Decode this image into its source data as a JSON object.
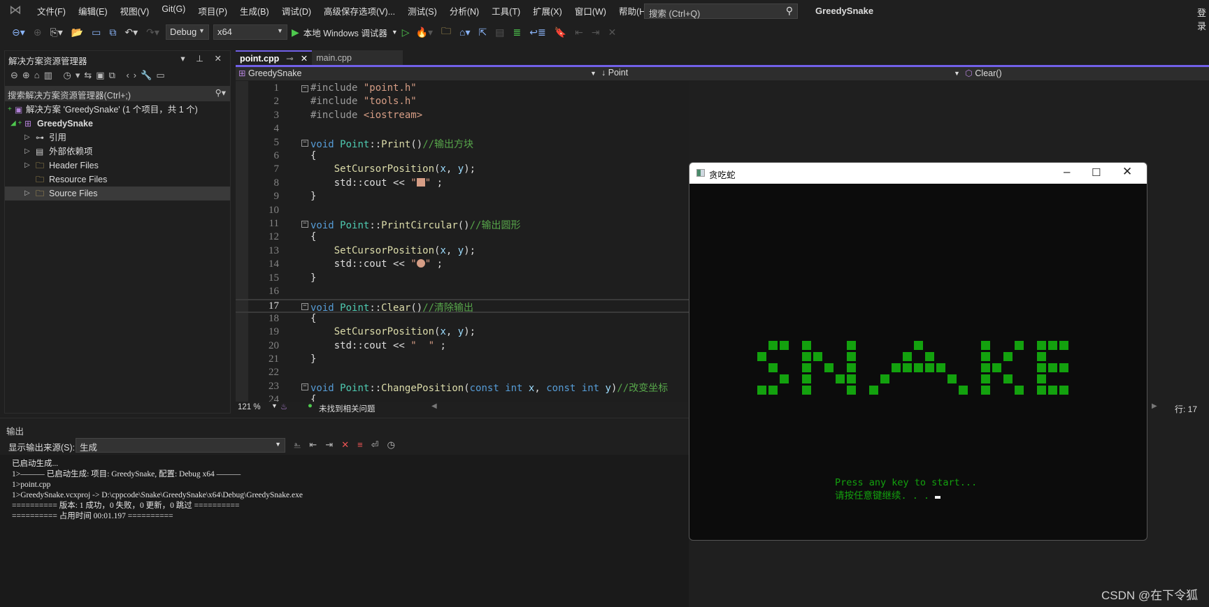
{
  "menubar": {
    "items": [
      "文件(F)",
      "编辑(E)",
      "视图(V)",
      "Git(G)",
      "项目(P)",
      "生成(B)",
      "调试(D)",
      "高级保存选项(V)...",
      "测试(S)",
      "分析(N)",
      "工具(T)",
      "扩展(X)",
      "窗口(W)",
      "帮助(H)"
    ],
    "search_placeholder": "搜索 (Ctrl+Q)",
    "app_title": "GreedySnake",
    "login": "登录"
  },
  "toolbar": {
    "config": "Debug",
    "platform": "x64",
    "run_label": "本地 Windows 调试器"
  },
  "solution_explorer": {
    "title": "解决方案资源管理器",
    "search_placeholder": "搜索解决方案资源管理器(Ctrl+;)",
    "items": [
      {
        "label": "解决方案 'GreedySnake' (1 个项目，共 1 个)",
        "icon": "solution-icon"
      },
      {
        "label": "GreedySnake",
        "icon": "project-icon"
      },
      {
        "label": "引用",
        "icon": "references-icon"
      },
      {
        "label": "外部依赖项",
        "icon": "external-deps-icon"
      },
      {
        "label": "Header Files",
        "icon": "filter-folder-icon"
      },
      {
        "label": "Resource Files",
        "icon": "filter-folder-icon"
      },
      {
        "label": "Source Files",
        "icon": "filter-folder-icon"
      }
    ]
  },
  "editor": {
    "tabs": [
      {
        "label": "point.cpp",
        "active": true
      },
      {
        "label": "main.cpp",
        "active": false
      }
    ],
    "nav": {
      "project": "GreedySnake",
      "scope": "Point",
      "member": "Clear()"
    },
    "current_line": 17,
    "lines": [
      [
        [
          "p",
          "#include "
        ],
        [
          "s",
          "\"point.h\""
        ]
      ],
      [
        [
          "p",
          "#include "
        ],
        [
          "s",
          "\"tools.h\""
        ]
      ],
      [
        [
          "p",
          "#include "
        ],
        [
          "s",
          "<iostream>"
        ]
      ],
      [],
      [
        [
          "k",
          "void "
        ],
        [
          "t",
          "Point"
        ],
        [
          "n",
          "::"
        ],
        [
          "f",
          "Print"
        ],
        [
          "n",
          "()"
        ],
        [
          "c",
          "//输出方块"
        ]
      ],
      [
        [
          "n",
          "{"
        ]
      ],
      [
        [
          "n",
          "    "
        ],
        [
          "f",
          "SetCursorPosition"
        ],
        [
          "n",
          "("
        ],
        [
          "v",
          "x"
        ],
        [
          "n",
          ", "
        ],
        [
          "v",
          "y"
        ],
        [
          "n",
          ");"
        ]
      ],
      [
        [
          "n",
          "    std::cout << "
        ],
        [
          "s",
          "\""
        ],
        [
          "blk",
          "■"
        ],
        [
          "s",
          "\""
        ],
        [
          "n",
          " ;"
        ]
      ],
      [
        [
          "n",
          "}"
        ]
      ],
      [],
      [
        [
          "k",
          "void "
        ],
        [
          "t",
          "Point"
        ],
        [
          "n",
          "::"
        ],
        [
          "f",
          "PrintCircular"
        ],
        [
          "n",
          "()"
        ],
        [
          "c",
          "//输出圆形"
        ]
      ],
      [
        [
          "n",
          "{"
        ]
      ],
      [
        [
          "n",
          "    "
        ],
        [
          "f",
          "SetCursorPosition"
        ],
        [
          "n",
          "("
        ],
        [
          "v",
          "x"
        ],
        [
          "n",
          ", "
        ],
        [
          "v",
          "y"
        ],
        [
          "n",
          ");"
        ]
      ],
      [
        [
          "n",
          "    std::cout << "
        ],
        [
          "s",
          "\""
        ],
        [
          "dot",
          "●"
        ],
        [
          "s",
          "\""
        ],
        [
          "n",
          " ;"
        ]
      ],
      [
        [
          "n",
          "}"
        ]
      ],
      [],
      [
        [
          "k",
          "void "
        ],
        [
          "t",
          "Point"
        ],
        [
          "n",
          "::"
        ],
        [
          "f",
          "Clear"
        ],
        [
          "n",
          "()"
        ],
        [
          "c",
          "//清除输出"
        ]
      ],
      [
        [
          "n",
          "{"
        ]
      ],
      [
        [
          "n",
          "    "
        ],
        [
          "f",
          "SetCursorPosition"
        ],
        [
          "n",
          "("
        ],
        [
          "v",
          "x"
        ],
        [
          "n",
          ", "
        ],
        [
          "v",
          "y"
        ],
        [
          "n",
          ");"
        ]
      ],
      [
        [
          "n",
          "    std::cout << "
        ],
        [
          "s",
          "\"  \""
        ],
        [
          "n",
          " ;"
        ]
      ],
      [
        [
          "n",
          "}"
        ]
      ],
      [],
      [
        [
          "k",
          "void "
        ],
        [
          "t",
          "Point"
        ],
        [
          "n",
          "::"
        ],
        [
          "f",
          "ChangePosition"
        ],
        [
          "n",
          "("
        ],
        [
          "k",
          "const int "
        ],
        [
          "v",
          "x"
        ],
        [
          "n",
          ", "
        ],
        [
          "k",
          "const int "
        ],
        [
          "v",
          "y"
        ],
        [
          "n",
          ")"
        ],
        [
          "c",
          "//改变坐标"
        ]
      ],
      [
        [
          "n",
          "{"
        ]
      ]
    ],
    "zoom": "121 %",
    "issues": "未找到相关问题",
    "position": "行: 17"
  },
  "output": {
    "title": "输出",
    "source_label": "显示输出来源(S):",
    "source_value": "生成",
    "lines": [
      "已启动生成...",
      "1>——— 已启动生成: 项目: GreedySnake, 配置: Debug x64 ———",
      "1>point.cpp",
      "1>GreedySnake.vcxproj -> D:\\cppcode\\Snake\\GreedySnake\\x64\\Debug\\GreedySnake.exe",
      "========== 版本: 1 成功，0 失败，0 更新，0 跳过 ==========",
      "========== 占用时间 00:01.197 =========="
    ]
  },
  "game_window": {
    "title": "贪吃蛇",
    "logo_text": "SNAKE",
    "logo_bitmap": [
      ".##.#...#.....#.....#..#.###",
      "#...##..#....#.#....#.#..#..",
      ".#..#.#.#...#####...##...###",
      "..#.#..##..#.....#..#.#..#..",
      "##..#...#.#.......#.#..#.###"
    ],
    "prompt_en": "Press any key to start...",
    "prompt_cn": "请按任意键继续. . .",
    "accent": "#13a10e"
  },
  "watermark": "CSDN @在下令狐"
}
